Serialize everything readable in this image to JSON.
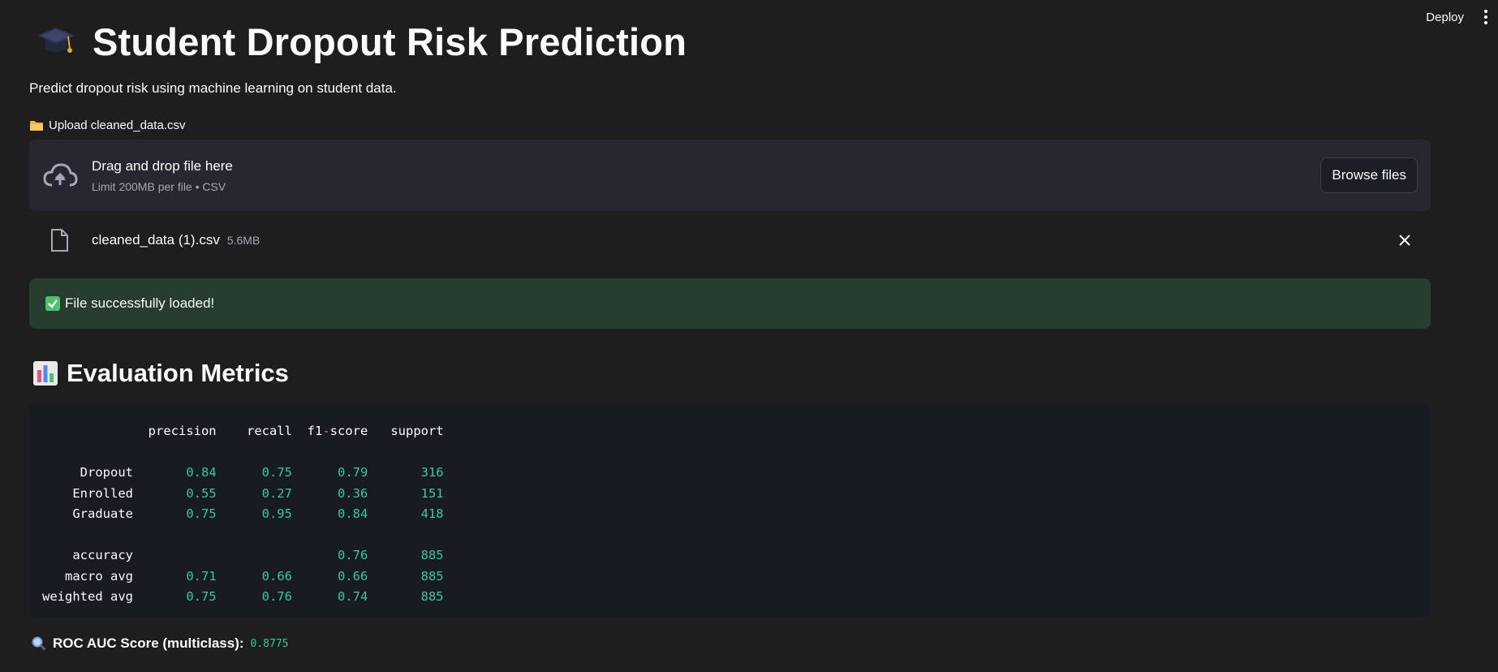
{
  "header": {
    "deploy_label": "Deploy",
    "menu_icon": "kebab-menu-icon"
  },
  "page": {
    "title": "Student Dropout Risk Prediction",
    "title_icon": "graduation-cap-icon",
    "subtitle": "Predict dropout risk using machine learning on student data."
  },
  "uploader": {
    "label": "Upload cleaned_data.csv",
    "label_icon": "folder-icon",
    "drop_title": "Drag and drop file here",
    "drop_sub": "Limit 200MB per file • CSV",
    "browse_label": "Browse files",
    "file": {
      "name": "cleaned_data (1).csv",
      "size": "5.6MB"
    }
  },
  "alert": {
    "message": "File successfully loaded!",
    "color": "#263d30"
  },
  "metrics": {
    "heading": "Evaluation Metrics",
    "heading_icon": "bar-chart-icon",
    "columns": [
      "precision",
      "recall",
      "f1-score",
      "support"
    ],
    "rows": [
      {
        "label": "Dropout",
        "values": [
          "0.84",
          "0.75",
          "0.79",
          "316"
        ]
      },
      {
        "label": "Enrolled",
        "values": [
          "0.55",
          "0.27",
          "0.36",
          "151"
        ]
      },
      {
        "label": "Graduate",
        "values": [
          "0.75",
          "0.95",
          "0.84",
          "418"
        ]
      }
    ],
    "summary": [
      {
        "label": "accuracy",
        "values": [
          "",
          "",
          "0.76",
          "885"
        ]
      },
      {
        "label": "macro avg",
        "values": [
          "0.71",
          "0.66",
          "0.66",
          "885"
        ]
      },
      {
        "label": "weighted avg",
        "values": [
          "0.75",
          "0.76",
          "0.74",
          "885"
        ]
      }
    ]
  },
  "roc": {
    "label": "ROC AUC Score (multiclass):",
    "value": "0.8775",
    "icon": "magnifier-icon"
  }
}
